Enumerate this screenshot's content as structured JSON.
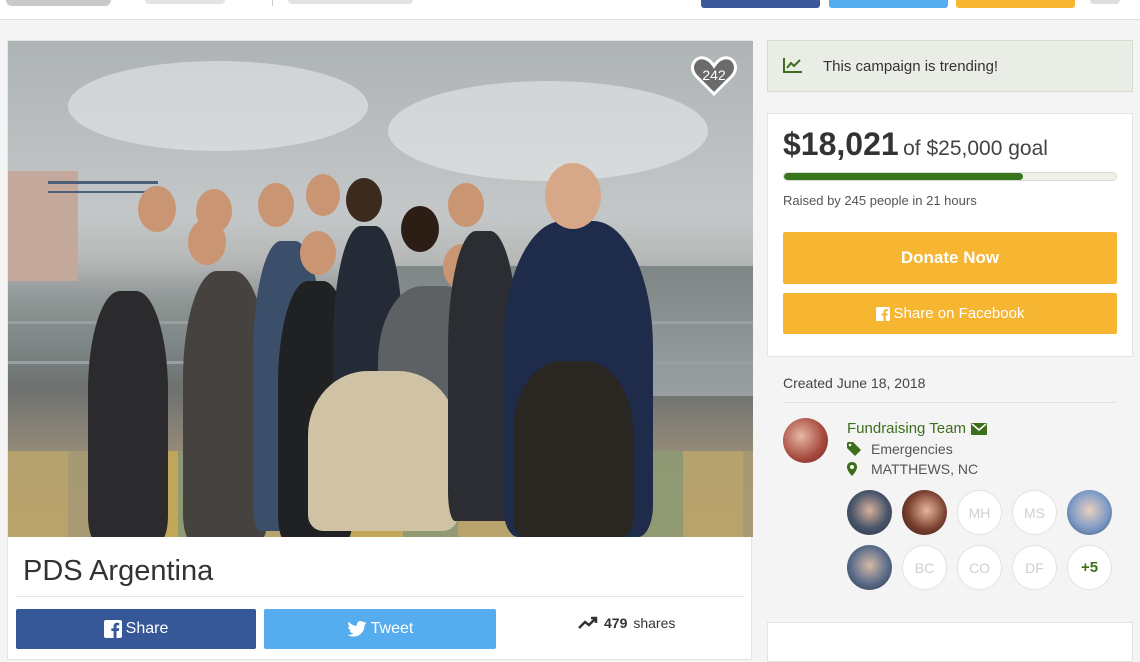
{
  "colors": {
    "facebook": "#365899",
    "twitter": "#55acee",
    "donate": "#f6b631",
    "progress": "#38761d",
    "organizer_link": "#3c6e1c"
  },
  "campaign": {
    "title": "PDS Argentina",
    "hearts": "242",
    "photo_icon": "group-photo"
  },
  "social": {
    "share_label": "Share",
    "tweet_label": "Tweet",
    "shares_count": "479",
    "shares_label": "shares"
  },
  "trending": {
    "icon": "trending-up-icon",
    "text": "This campaign is trending!"
  },
  "progress": {
    "raised": "$18,021",
    "goal_text": "of $25,000 goal",
    "raised_fraction": 0.72,
    "raised_by": "Raised by 245 people in 21 hours",
    "donate_label": "Donate Now",
    "facebook_label": "Share on Facebook"
  },
  "meta": {
    "created": "Created June 18, 2018"
  },
  "organizer": {
    "name": "Fundraising Team",
    "category": "Emergencies",
    "location": "MATTHEWS, NC"
  },
  "team": {
    "members": [
      {
        "initials": ""
      },
      {
        "initials": ""
      },
      {
        "initials": "MH"
      },
      {
        "initials": "MS"
      },
      {
        "initials": ""
      },
      {
        "initials": ""
      },
      {
        "initials": "BC"
      },
      {
        "initials": "CO"
      },
      {
        "initials": "DF"
      },
      {
        "initials": "+5"
      }
    ]
  }
}
